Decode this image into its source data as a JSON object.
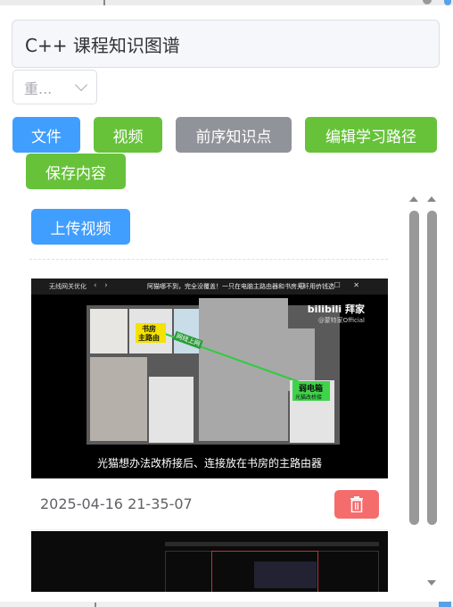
{
  "page_title": "C++ 课程知识图谱",
  "select": {
    "value": "重..."
  },
  "toolbar": {
    "file_label": "文件",
    "video_label": "视频",
    "prereq_label": "前序知识点",
    "edit_path_label": "编辑学习路径",
    "save_label": "保存内容"
  },
  "upload_label": "上传视频",
  "videos": [
    {
      "date": "2025-04-16 21-35-07",
      "thumbnail": {
        "window_header": "阿猫哪不到，完全没覆盖！一只在电脑主路由器和书房光纤用价钱选",
        "home_tab": "无线网关优化",
        "caption": "光猫想办法改桥接后、连接放在书房的主路由器",
        "logo": "bilibili 拜家",
        "logo_sub": "@蒙特家Official",
        "label_study": "书房",
        "label_router": "主路由",
        "label_box": "弱电箱",
        "label_box_sub": "光猫改桥接",
        "line_label": "网线上网"
      }
    }
  ],
  "icons": {
    "delete": "trash-icon",
    "chevron": "chevron-down-icon"
  },
  "colors": {
    "primary": "#409eff",
    "success": "#67c23a",
    "info": "#909399",
    "danger": "#f56c6c"
  }
}
